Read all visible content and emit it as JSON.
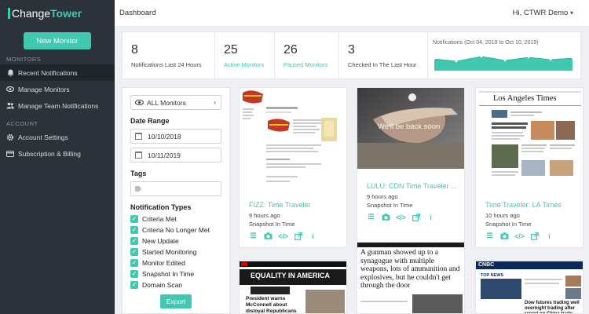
{
  "app": {
    "logo_prefix": "i",
    "logo_change": "Change",
    "logo_tower": "Tower"
  },
  "sidebar": {
    "new_monitor": "New Monitor",
    "sections": [
      {
        "label": "MONITORS"
      },
      {
        "label": "ACCOUNT"
      }
    ],
    "items": [
      {
        "label": "Recent Notifications",
        "icon": "bell-icon"
      },
      {
        "label": "Manage Monitors",
        "icon": "eye-icon"
      },
      {
        "label": "Manage Team Notifications",
        "icon": "users-icon"
      },
      {
        "label": "Account Settings",
        "icon": "gear-icon"
      },
      {
        "label": "Subscription & Billing",
        "icon": "credit-card-icon"
      }
    ]
  },
  "header": {
    "breadcrumb": "Dashboard",
    "greeting": "Hi, CTWR Demo",
    "greeting_caret": "▾"
  },
  "stats": [
    {
      "value": "8",
      "label": "Notifications Last 24 Hours"
    },
    {
      "value": "25",
      "label": "Active Monitors"
    },
    {
      "value": "26",
      "label": "Paused Monitors"
    },
    {
      "value": "3",
      "label": "Checked In The Last Hour"
    }
  ],
  "sparkline": {
    "title": "Notifications (Oct 04, 2019 to Oct 10, 2019)",
    "color": "#3ec9b0"
  },
  "filters": {
    "monitor_select": "ALL Monitors",
    "date_range_label": "Date Range",
    "date_from": "10/10/2018",
    "date_to": "10/11/2019",
    "tags_label": "Tags",
    "types_label": "Notification Types",
    "types": [
      "Criteria Met",
      "Criteria No Longer Met",
      "New Update",
      "Started Monitoring",
      "Monitor Edited",
      "Snapshot In Time",
      "Domain Scan"
    ],
    "export": "Export"
  },
  "cards": [
    {
      "title": "FIZZ: Time Traveler",
      "time": "9 hours ago",
      "snapshot": "Snapshot In Time"
    },
    {
      "title": "LULU: CDN Time Traveler ...",
      "time": "9 hours ago",
      "snapshot": "Snapshot In Time",
      "overlay": "We'll be back soon"
    },
    {
      "title": "Time Traveler: LA Times",
      "time": "10 hours ago",
      "snapshot": "Snapshot In Time",
      "masthead": "Los Angeles Times"
    }
  ],
  "bottom_cards": {
    "equality": "EQUALITY IN AMERICA",
    "headline1": "President warns McConnell about disloyal Republicans",
    "article": "A gunman showed up to a synagogue with multiple weapons, lots of ammunition and explosives, but he couldn't get through the door",
    "cnbc": "CNBC",
    "top_news": "TOP NEWS",
    "headline3": "Dow futures trading well overnight trading after report on China trade"
  },
  "colors": {
    "accent": "#3ec9b0",
    "sidebar": "#2b323a"
  }
}
